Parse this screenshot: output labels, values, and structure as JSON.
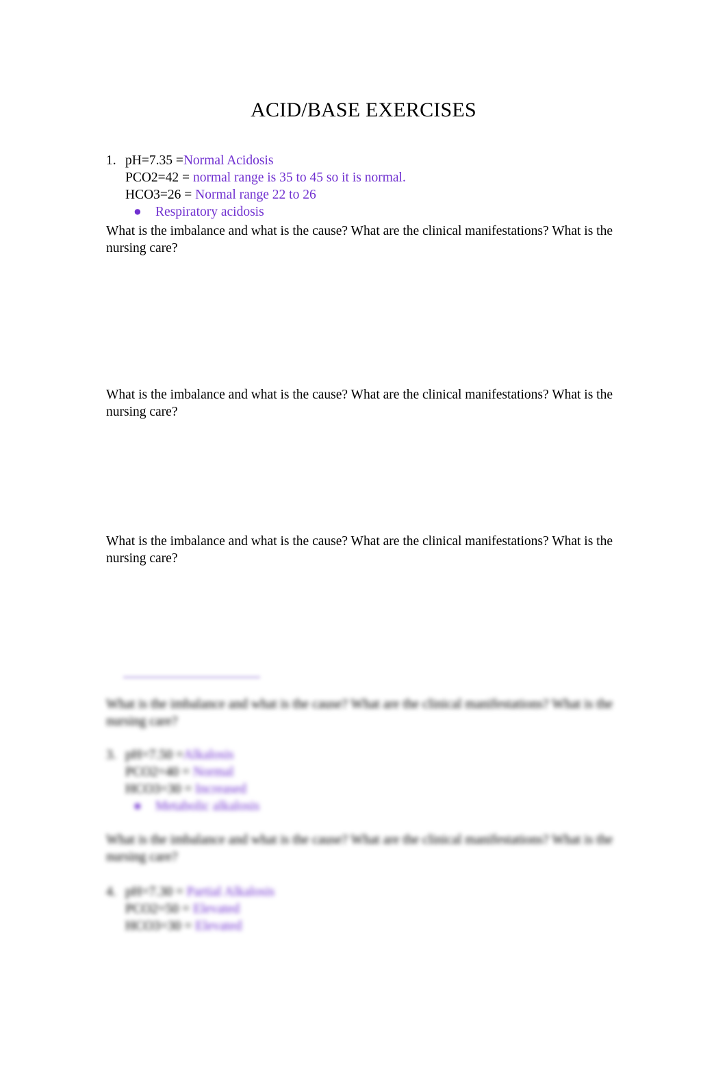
{
  "document": {
    "title": "ACID/BASE EXERCISES"
  },
  "question_prompt": "What is the imbalance and what is the cause? What are the clinical manifestations? What is the nursing care?",
  "exercises": [
    {
      "number": "1.",
      "ph_label": "pH=7.35 =",
      "ph_answer": "Normal Acidosis",
      "pco2_label": "PCO2=42 = ",
      "pco2_answer": "normal range is 35 to 45 so it is normal.",
      "hco3_label": "HCO3=26 = ",
      "hco3_answer": "Normal range 22 to 26",
      "bullet": "Respiratory acidosis"
    },
    {
      "number": "3.",
      "ph_label": "pH=7.50 =",
      "ph_answer": "Alkalosis",
      "pco2_label": "PCO2=40 = ",
      "pco2_answer": "Normal",
      "hco3_label": "HCO3=30 = ",
      "hco3_answer": "Increased",
      "bullet": "Metabolic alkalosis"
    },
    {
      "number": "4.",
      "ph_label": "pH=7.30 = ",
      "ph_answer": "Partial Alkalosis",
      "pco2_label": "PCO2=50 = ",
      "pco2_answer": "Elevated",
      "hco3_label": "HCO3=30 = ",
      "hco3_answer": "Elevated",
      "bullet": ""
    }
  ],
  "colors": {
    "answer_purple": "#7030d0",
    "text_black": "#000000",
    "page_background": "#ffffff"
  }
}
